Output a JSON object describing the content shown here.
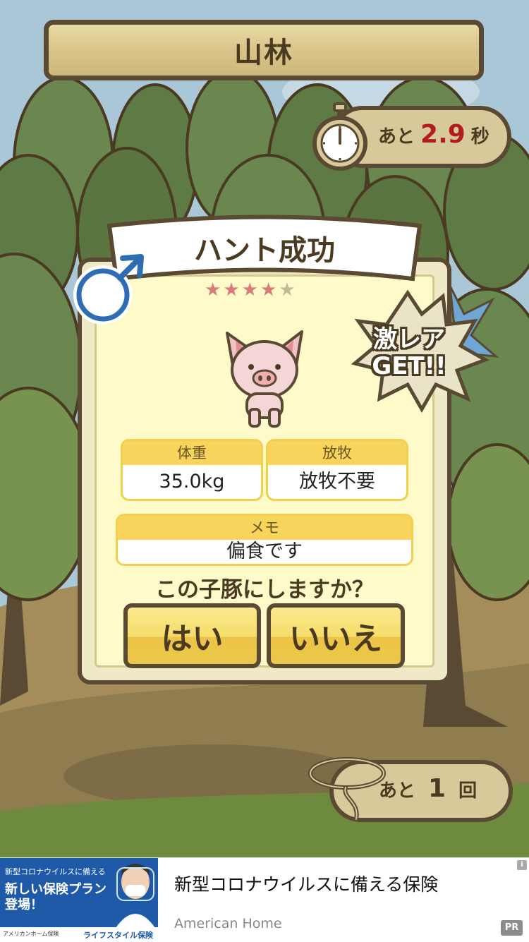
{
  "location": {
    "title": "山林"
  },
  "timer": {
    "prefix": "あと",
    "value": "2.9",
    "unit": "秒"
  },
  "result": {
    "title": "ハント成功",
    "gender_label": "オス",
    "rarity": {
      "stars": 4,
      "max_stars": 5
    },
    "rare_badge": [
      "激レア",
      "GET!!"
    ],
    "weight": {
      "label": "体重",
      "value": "35.0kg"
    },
    "grazing": {
      "label": "放牧",
      "value": "放牧不要"
    },
    "memo": {
      "label": "メモ",
      "value": "偏食です"
    },
    "question": "この子豚にしますか？",
    "yes_label": "はい",
    "no_label": "いいえ"
  },
  "attempts": {
    "prefix": "あと",
    "value": "1",
    "unit": "回"
  },
  "ad": {
    "thumbnail_line1": "新型コロナウイルスに備える",
    "thumbnail_line2": "新しい保険プラン",
    "thumbnail_line3": "登場！",
    "thumbnail_footer_left": "アメリカンホーム保険",
    "thumbnail_footer_right": "ライフスタイル保険",
    "title": "新型コロナウイルスに備える保険",
    "advertiser": "American Home",
    "pr_label": "PR",
    "info_label": "i"
  },
  "colors": {
    "frame": "#5a4a33",
    "timer_number": "#b11d1d",
    "field_header": "#f7d55d",
    "button": "#f6dd6b"
  }
}
